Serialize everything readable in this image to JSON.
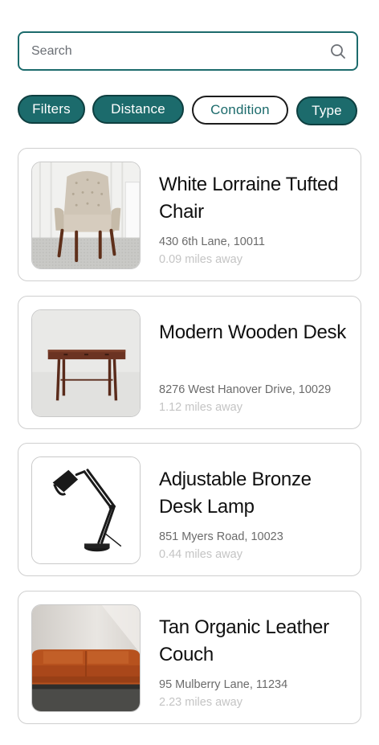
{
  "search": {
    "placeholder": "Search",
    "icon": "search-icon"
  },
  "filters": [
    {
      "label": "Filters",
      "style": "filled"
    },
    {
      "label": "Distance",
      "style": "filled"
    },
    {
      "label": "Condition",
      "style": "outline"
    },
    {
      "label": "Type",
      "style": "filled"
    }
  ],
  "colors": {
    "accent": "#1c6b6c",
    "chip_border": "#0e3f40",
    "card_border": "#cfcfcf"
  },
  "listings": [
    {
      "title": "White Lorraine Tufted Chair",
      "address": "430 6th Lane, 10011",
      "distance": "0.09 miles away",
      "image": "tufted-chair-photo"
    },
    {
      "title": "Modern Wooden Desk",
      "address": "8276 West Hanover Drive, 10029",
      "distance": "1.12 miles away",
      "image": "wooden-desk-photo"
    },
    {
      "title": "Adjustable Bronze Desk Lamp",
      "address": "851 Myers Road, 10023",
      "distance": "0.44 miles away",
      "image": "desk-lamp-photo"
    },
    {
      "title": "Tan Organic Leather Couch",
      "address": "95 Mulberry Lane, 11234",
      "distance": "2.23 miles away",
      "image": "leather-couch-photo"
    }
  ]
}
